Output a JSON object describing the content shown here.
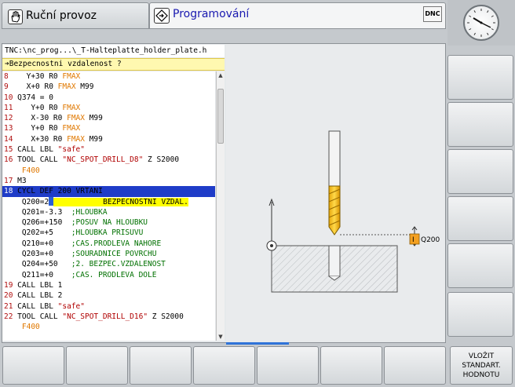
{
  "tabs": {
    "manual": "Ruční provoz",
    "programming": "Programování"
  },
  "dnc_label": "DNC",
  "editor": {
    "path": "TNC:\\nc_prog...\\_T-Halteplatte_holder_plate.h",
    "prompt": "➔Bezpecnostni vzdalenost ?"
  },
  "program_lines": [
    {
      "n": "8",
      "parts": [
        [
          "    Y+30 R0 ",
          "kw"
        ],
        [
          "FMAX",
          "orange"
        ]
      ]
    },
    {
      "n": "9",
      "parts": [
        [
          "    X+0 R0 ",
          "kw"
        ],
        [
          "FMAX",
          "orange"
        ],
        [
          " M99",
          "kw"
        ]
      ]
    },
    {
      "n": "10",
      "parts": [
        [
          " Q374 = 0",
          "kw"
        ]
      ]
    },
    {
      "n": "11",
      "parts": [
        [
          "    Y+0 R0 ",
          "kw"
        ],
        [
          "FMAX",
          "orange"
        ]
      ]
    },
    {
      "n": "12",
      "parts": [
        [
          "    X-30 R0 ",
          "kw"
        ],
        [
          "FMAX",
          "orange"
        ],
        [
          " M99",
          "kw"
        ]
      ]
    },
    {
      "n": "13",
      "parts": [
        [
          "    Y+0 R0 ",
          "kw"
        ],
        [
          "FMAX",
          "orange"
        ]
      ]
    },
    {
      "n": "14",
      "parts": [
        [
          "    X+30 R0 ",
          "kw"
        ],
        [
          "FMAX",
          "orange"
        ],
        [
          " M99",
          "kw"
        ]
      ]
    },
    {
      "n": "15",
      "parts": [
        [
          " CALL LBL ",
          "kw"
        ],
        [
          "\"safe\"",
          "str"
        ]
      ]
    },
    {
      "n": "16",
      "parts": [
        [
          " TOOL CALL ",
          "kw"
        ],
        [
          "\"NC_SPOT_DRILL_D8\"",
          "str"
        ],
        [
          " Z S2000",
          "kw"
        ]
      ]
    },
    {
      "n": "",
      "parts": [
        [
          "    F400",
          "orange"
        ]
      ]
    },
    {
      "n": "17",
      "parts": [
        [
          " M3",
          "kw"
        ]
      ]
    },
    {
      "n": "18",
      "parts": [
        [
          " CYCL DEF 200 VRTANI",
          "kw"
        ]
      ],
      "selected": true
    },
    {
      "n": "",
      "parts": [
        [
          "    Q200=2",
          "kw"
        ],
        [
          "CURSOR",
          "cursor"
        ],
        [
          "           BEZPECNOSTNI VZDAL.",
          "hl"
        ]
      ]
    },
    {
      "n": "",
      "parts": [
        [
          "    Q201=-3.3  ",
          "kw"
        ],
        [
          ";HLOUBKA",
          "green"
        ]
      ]
    },
    {
      "n": "",
      "parts": [
        [
          "    Q206=+150  ",
          "kw"
        ],
        [
          ";POSUV NA HLOUBKU",
          "green"
        ]
      ]
    },
    {
      "n": "",
      "parts": [
        [
          "    Q202=+5    ",
          "kw"
        ],
        [
          ";HLOUBKA PRISUVU",
          "green"
        ]
      ]
    },
    {
      "n": "",
      "parts": [
        [
          "    Q210=+0    ",
          "kw"
        ],
        [
          ";CAS.PRODLEVA NAHORE",
          "green"
        ]
      ]
    },
    {
      "n": "",
      "parts": [
        [
          "    Q203=+0    ",
          "kw"
        ],
        [
          ";SOURADNICE POVRCHU",
          "green"
        ]
      ]
    },
    {
      "n": "",
      "parts": [
        [
          "    Q204=+50   ",
          "kw"
        ],
        [
          ";2. BEZPEC.VZDALENOST",
          "green"
        ]
      ]
    },
    {
      "n": "",
      "parts": [
        [
          "    Q211=+0    ",
          "kw"
        ],
        [
          ";CAS. PRODLEVA DOLE",
          "green"
        ]
      ]
    },
    {
      "n": "19",
      "parts": [
        [
          " CALL LBL 1",
          "kw"
        ]
      ]
    },
    {
      "n": "20",
      "parts": [
        [
          " CALL LBL 2",
          "kw"
        ]
      ]
    },
    {
      "n": "21",
      "parts": [
        [
          " CALL LBL ",
          "kw"
        ],
        [
          "\"safe\"",
          "str"
        ]
      ]
    },
    {
      "n": "22",
      "parts": [
        [
          " TOOL CALL ",
          "kw"
        ],
        [
          "\"NC_SPOT_DRILL_D16\"",
          "str"
        ],
        [
          " Z S2000",
          "kw"
        ]
      ]
    },
    {
      "n": "",
      "parts": [
        [
          "    F400",
          "orange"
        ]
      ]
    }
  ],
  "graphic": {
    "q_label": "Q200"
  },
  "softkeys_bottom": {
    "insert_default": [
      "VLOŽIT",
      "STANDART.",
      "HODNOTU"
    ]
  },
  "colors": {
    "selection": "#1f3cc8",
    "prompt_bg": "#fff8b0",
    "highlight": "#ffff00"
  }
}
